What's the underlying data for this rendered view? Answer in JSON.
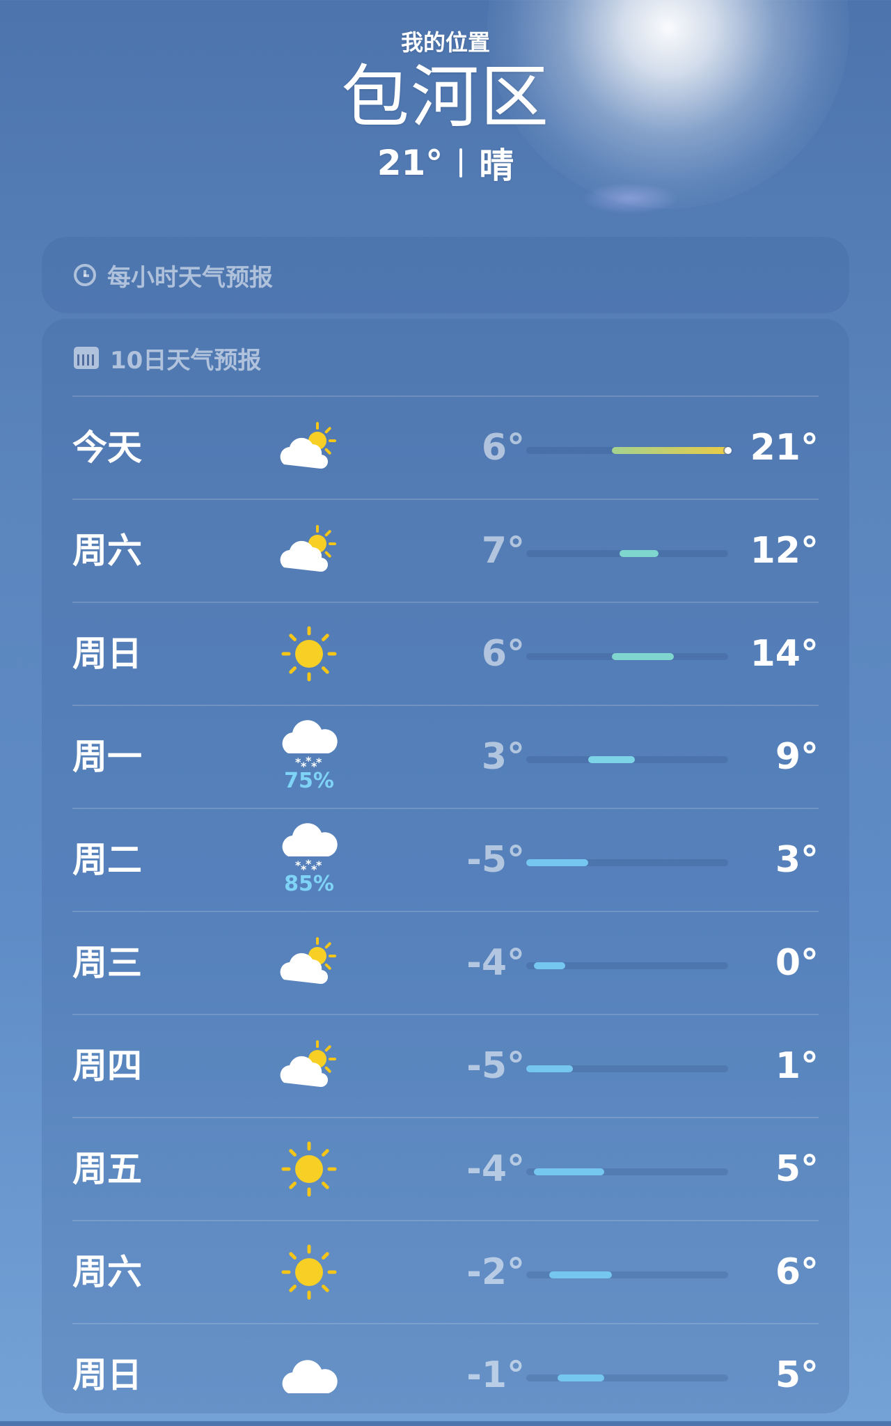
{
  "header": {
    "my_location": "我的位置",
    "city": "包河区",
    "current_temp": "21°",
    "condition": "晴"
  },
  "hourly": {
    "title": "每小时天气预报",
    "icon": "clock-icon"
  },
  "daily": {
    "title": "10日天气预报",
    "icon": "calendar-icon",
    "range_min": -5,
    "range_max": 21,
    "days": [
      {
        "label": "今天",
        "icon": "partly-cloudy-icon",
        "low": "6°",
        "high": "21°",
        "low_value": 6,
        "high_value": 21,
        "current_value": 21,
        "bar_color": "linear-gradient(90deg,#a4d28f,#eacb46)"
      },
      {
        "label": "周六",
        "icon": "partly-cloudy-icon",
        "low": "7°",
        "high": "12°",
        "low_value": 7,
        "high_value": 12,
        "bar_color": "#7fd6cf"
      },
      {
        "label": "周日",
        "icon": "sun-icon",
        "low": "6°",
        "high": "14°",
        "low_value": 6,
        "high_value": 14,
        "bar_color": "#7fd6cf"
      },
      {
        "label": "周一",
        "icon": "snow-icon",
        "precip": "75%",
        "low": "3°",
        "high": "9°",
        "low_value": 3,
        "high_value": 9,
        "bar_color": "#7cd4e6"
      },
      {
        "label": "周二",
        "icon": "snow-icon",
        "precip": "85%",
        "low": "-5°",
        "high": "3°",
        "low_value": -5,
        "high_value": 3,
        "bar_color": "#76c7f0"
      },
      {
        "label": "周三",
        "icon": "partly-cloudy-icon",
        "low": "-4°",
        "high": "0°",
        "low_value": -4,
        "high_value": 0,
        "bar_color": "#76c7f0"
      },
      {
        "label": "周四",
        "icon": "partly-cloudy-icon",
        "low": "-5°",
        "high": "1°",
        "low_value": -5,
        "high_value": 1,
        "bar_color": "#76c7f0"
      },
      {
        "label": "周五",
        "icon": "sun-icon",
        "low": "-4°",
        "high": "5°",
        "low_value": -4,
        "high_value": 5,
        "bar_color": "#76c7f0"
      },
      {
        "label": "周六",
        "icon": "sun-icon",
        "low": "-2°",
        "high": "6°",
        "low_value": -2,
        "high_value": 6,
        "bar_color": "#76c7f0"
      },
      {
        "label": "周日",
        "icon": "cloud-icon",
        "low": "-1°",
        "high": "5°",
        "low_value": -1,
        "high_value": 5,
        "bar_color": "#76c7f0"
      }
    ]
  }
}
